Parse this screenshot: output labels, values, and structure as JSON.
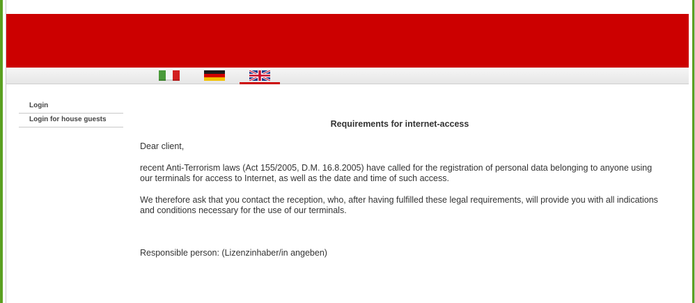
{
  "languages": [
    {
      "code": "it",
      "icon": "italy-flag-icon",
      "active": false
    },
    {
      "code": "de",
      "icon": "germany-flag-icon",
      "active": false
    },
    {
      "code": "en",
      "icon": "uk-flag-icon",
      "active": true
    }
  ],
  "colors": {
    "banner": "#cc0000",
    "frame_border": "#5aa020",
    "active_tab": "#cc0000",
    "text": "#333333"
  },
  "sidebar": {
    "items": [
      {
        "label": "Login"
      },
      {
        "label": "Login for house guests"
      }
    ]
  },
  "main": {
    "title": "Requirements for internet-access",
    "greeting": "Dear client,",
    "paragraph1": "recent Anti-Terrorism laws (Act 155/2005, D.M. 16.8.2005) have called for the registration of personal data belonging to anyone using our terminals for access to Internet, as well as the date and time of such access.",
    "paragraph2": "We therefore ask that you contact the reception, who, after having fulfilled these legal requirements, will provide you with all indications and conditions necessary for the use of our terminals.",
    "responsible": "Responsible person: (Lizenzinhaber/in angeben)"
  }
}
